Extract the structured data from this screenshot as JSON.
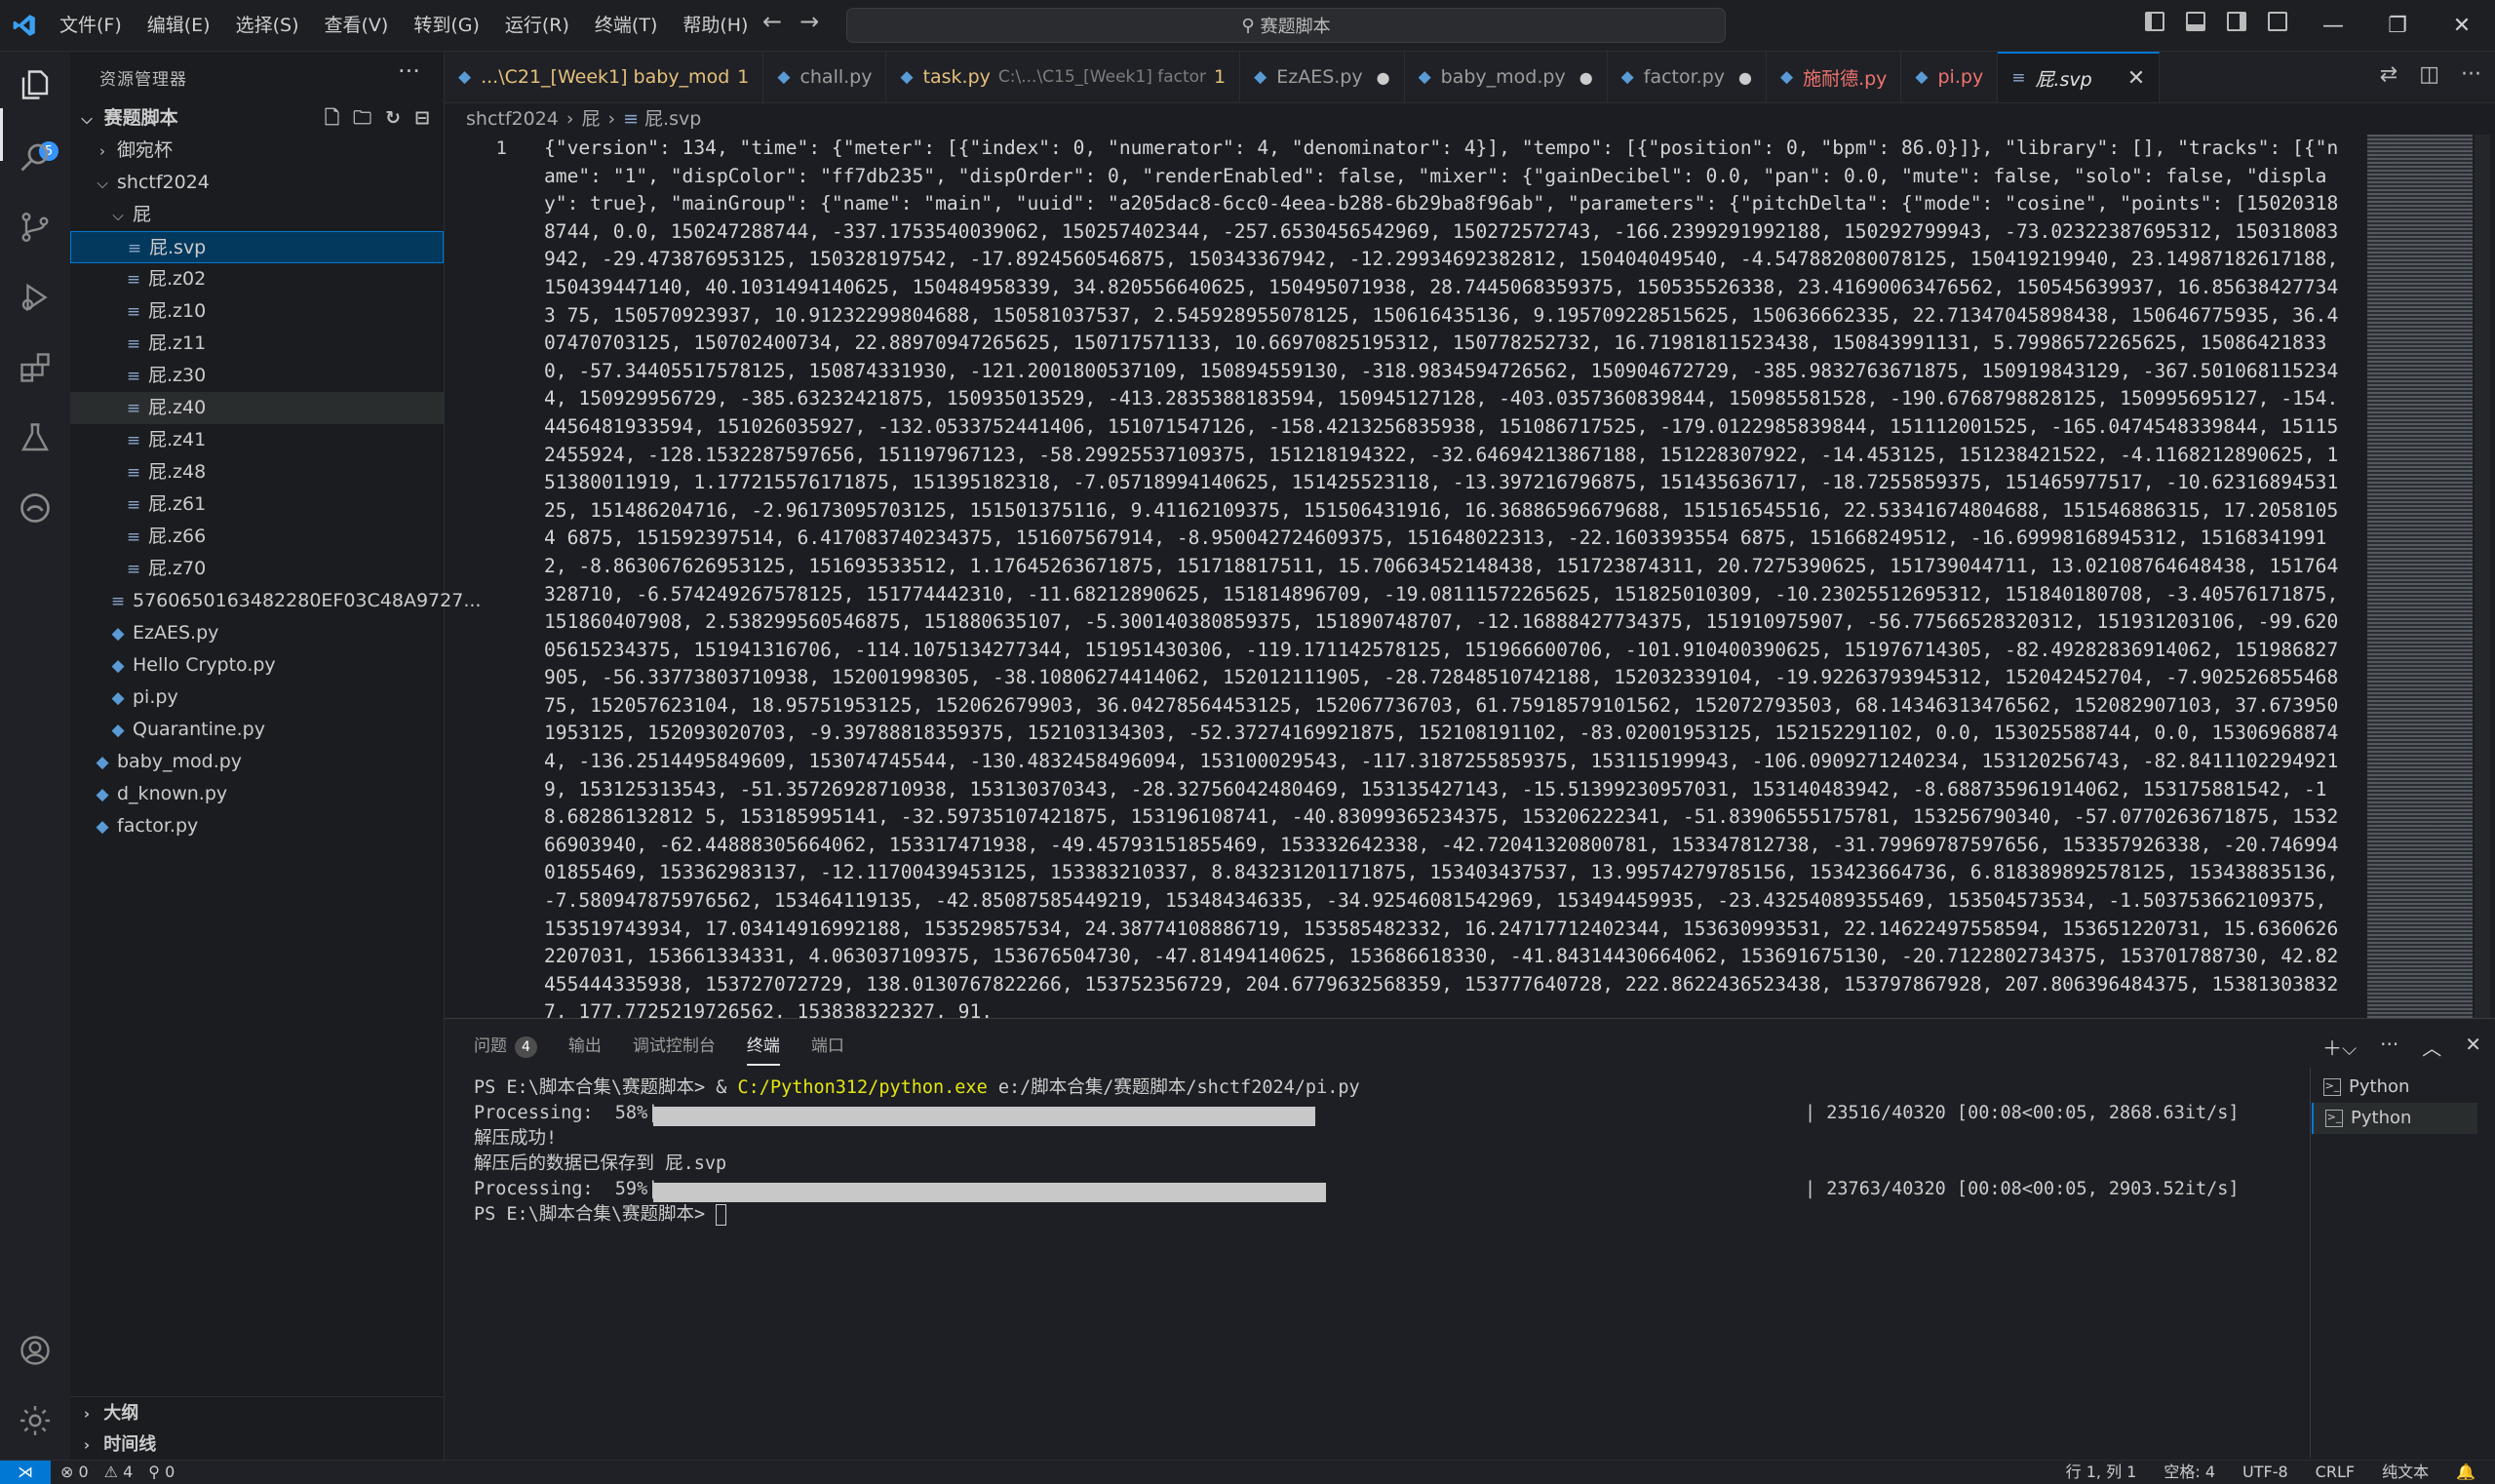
{
  "menu": [
    "文件(F)",
    "编辑(E)",
    "选择(S)",
    "查看(V)",
    "转到(G)",
    "运行(R)",
    "终端(T)",
    "帮助(H)"
  ],
  "search": {
    "label": "赛题脚本"
  },
  "colors": {
    "accent": "#0078d4",
    "selection": "#04395e",
    "terminal_path": "#e5e510",
    "error_tab": "#f0736e"
  },
  "activity": {
    "explorer_badge": "5"
  },
  "sidebar": {
    "title": "资源管理器",
    "root": "赛题脚本",
    "items": [
      {
        "label": "御宛杯",
        "type": "folder",
        "level": 1,
        "open": false
      },
      {
        "label": "shctf2024",
        "type": "folder",
        "level": 1,
        "open": true
      },
      {
        "label": "屁",
        "type": "folder",
        "level": 2,
        "open": true
      },
      {
        "label": "屁.svp",
        "type": "svp",
        "level": 3,
        "selected": true
      },
      {
        "label": "屁.z02",
        "type": "svp",
        "level": 3
      },
      {
        "label": "屁.z10",
        "type": "svp",
        "level": 3
      },
      {
        "label": "屁.z11",
        "type": "svp",
        "level": 3
      },
      {
        "label": "屁.z30",
        "type": "svp",
        "level": 3
      },
      {
        "label": "屁.z40",
        "type": "svp",
        "level": 3,
        "hover": true
      },
      {
        "label": "屁.z41",
        "type": "svp",
        "level": 3
      },
      {
        "label": "屁.z48",
        "type": "svp",
        "level": 3
      },
      {
        "label": "屁.z61",
        "type": "svp",
        "level": 3
      },
      {
        "label": "屁.z66",
        "type": "svp",
        "level": 3
      },
      {
        "label": "屁.z70",
        "type": "svp",
        "level": 3
      },
      {
        "label": "5760650163482280EF03C48A9727...",
        "type": "svp",
        "level": 2
      },
      {
        "label": "EzAES.py",
        "type": "py",
        "level": 2
      },
      {
        "label": "Hello Crypto.py",
        "type": "py",
        "level": 2
      },
      {
        "label": "pi.py",
        "type": "py",
        "level": 2
      },
      {
        "label": "Quarantine.py",
        "type": "py",
        "level": 2
      },
      {
        "label": "baby_mod.py",
        "type": "py",
        "level": 1
      },
      {
        "label": "d_known.py",
        "type": "py",
        "level": 1
      },
      {
        "label": "factor.py",
        "type": "py",
        "level": 1
      }
    ],
    "outline": "大纲",
    "timeline": "时间线"
  },
  "tabs": [
    {
      "label": "...\\C21_[Week1] baby_mod",
      "count": "1",
      "style": "warn"
    },
    {
      "label": "chall.py",
      "style": "normal"
    },
    {
      "label": "task.py",
      "desc": "C:\\...\\C15_[Week1] factor",
      "count": "1",
      "style": "warn"
    },
    {
      "label": "EzAES.py",
      "dot": "●",
      "style": "normal"
    },
    {
      "label": "baby_mod.py",
      "dot": "●",
      "style": "normal"
    },
    {
      "label": "factor.py",
      "dot": "●",
      "style": "normal"
    },
    {
      "label": "施耐德.py",
      "style": "err"
    },
    {
      "label": "pi.py",
      "style": "err"
    },
    {
      "label": "屁.svp",
      "style": "active",
      "close": "✕"
    }
  ],
  "breadcrumb": {
    "parts": [
      "shctf2024",
      "屁",
      "屁.svp"
    ]
  },
  "editor": {
    "line_number": "1",
    "code": "{\"version\": 134, \"time\": {\"meter\": [{\"index\": 0, \"numerator\": 4, \"denominator\": 4}], \"tempo\": [{\"position\": 0, \"bpm\": 86.0}]}, \"library\": [], \"tracks\": [{\"name\": \"1\", \"dispColor\": \"ff7db235\", \"dispOrder\": 0, \"renderEnabled\": false, \"mixer\": {\"gainDecibel\": 0.0, \"pan\": 0.0, \"mute\": false, \"solo\": false, \"display\": true}, \"mainGroup\": {\"name\": \"main\", \"uuid\": \"a205dac8-6cc0-4eea-b288-6b29ba8f96ab\", \"parameters\": {\"pitchDelta\": {\"mode\": \"cosine\", \"points\": [150203188744, 0.0, 150247288744, -337.1753540039062, 150257402344, -257.6530456542969, 150272572743, -166.2399291992188, 150292799943, -73.02322387695312, 150318083942, -29.473876953125, 150328197542, -17.8924560546875, 150343367942, -12.29934692382812, 150404049540, -4.547882080078125, 150419219940, 23.14987182617188, 150439447140, 40.1031494140625, 150484958339, 34.820556640625, 150495071938, 28.7445068359375, 150535526338, 23.41690063476562, 150545639937, 16.856384277343 75, 150570923937, 10.91232299804688, 150581037537, 2.545928955078125, 150616435136, 9.195709228515625, 150636662335, 22.71347045898438, 150646775935, 36.407470703125, 150702400734, 22.88970947265625, 150717571133, 10.66970825195312, 150778252732, 16.71981811523438, 150843991131, 5.79986572265625, 150864218330, -57.34405517578125, 150874331930, -121.2001800537109, 150894559130, -318.9834594726562, 150904672729, -385.9832763671875, 150919843129, -367.5010681152344, 150929956729, -385.63232421875, 150935013529, -413.2835388183594, 150945127128, -403.0357360839844, 150985581528, -190.6768798828125, 150995695127, -154.4456481933594, 151026035927, -132.0533752441406, 151071547126, -158.4213256835938, 151086717525, -179.0122985839844, 151112001525, -165.0474548339844, 151152455924, -128.1532287597656, 151197967123, -58.29925537109375, 151218194322, -32.64694213867188, 151228307922, -14.453125, 151238421522, -4.1168212890625, 151380011919, 1.177215576171875, 151395182318, -7.05718994140625, 151425523118, -13.397216796875, 151435636717, -18.7255859375, 151465977517, -10.6231689453125, 151486204716, -2.96173095703125, 151501375116, 9.41162109375, 151506431916, 16.36886596679688, 151516545516, 22.53341674804688, 151546886315, 17.20581054 6875, 151592397514, 6.417083740234375, 151607567914, -8.950042724609375, 151648022313, -22.1603393554 6875, 151668249512, -16.69998168945312, 151683419912, -8.863067626953125, 151693533512, 1.17645263671875, 151718817511, 15.70663452148438, 151723874311, 20.7275390625, 151739044711, 13.02108764648438, 151764328710, -6.574249267578125, 151774442310, -11.68212890625, 151814896709, -19.08111572265625, 151825010309, -10.23025512695312, 151840180708, -3.40576171875, 151860407908, 2.538299560546875, 151880635107, -5.300140380859375, 151890748707, -12.16888427734375, 151910975907, -56.77566528320312, 151931203106, -99.62005615234375, 151941316706, -114.1075134277344, 151951430306, -119.171142578125, 151966600706, -101.910400390625, 151976714305, -82.49282836914062, 151986827905, -56.33773803710938, 152001998305, -38.10806274414062, 152012111905, -28.72848510742188, 152032339104, -19.92263793945312, 152042452704, -7.90252685546875, 152057623104, 18.95751953125, 152062679903, 36.04278564453125, 152067736703, 61.75918579101562, 152072793503, 68.14346313476562, 152082907103, 37.6739501953125, 152093020703, -9.39788818359375, 152103134303, -52.37274169921875, 152108191102, -83.02001953125, 152152291102, 0.0, 153025588744, 0.0, 153069688744, -136.2514495849609, 153074745544, -130.4832458496094, 153100029543, -117.3187255859375, 153115199943, -106.0909271240234, 153120256743, -82.84111022949219, 153125313543, -51.35726928710938, 153130370343, -28.32756042480469, 153135427143, -15.51399230957031, 153140483942, -8.688735961914062, 153175881542, -18.68286132812 5, 153185995141, -32.59735107421875, 153196108741, -40.83099365234375, 153206222341, -51.83906555175781, 153256790340, -57.0770263671875, 153266903940, -62.44888305664062, 153317471938, -49.45793151855469, 153332642338, -42.72041320800781, 153347812738, -31.79969787597656, 153357926338, -20.74699401855469, 153362983137, -12.11700439453125, 153383210337, 8.843231201171875, 153403437537, 13.99574279785156, 153423664736, 6.818389892578125, 153438835136, -7.580947875976562, 153464119135, -42.85087585449219, 153484346335, -34.92546081542969, 153494459935, -23.43254089355469, 153504573534, -1.503753662109375, 153519743934, 17.03414916992188, 153529857534, 24.38774108886719, 153585482332, 16.24717712402344, 153630993531, 22.14622497558594, 153651220731, 15.63606262207031, 153661334331, 4.063037109375, 153676504730, -47.81494140625, 153686618330, -41.84314430664062, 153691675130, -20.7122802734375, 153701788730, 42.82455444335938, 153727072729, 138.0130767822266, 153752356729, 204.6779632568359, 153777640728, 222.8622436523438, 153797867928, 207.806396484375, 153813038327, 177.7725219726562, 153838322327, 91."
  },
  "panel": {
    "tabs": [
      "问题",
      "输出",
      "调试控制台",
      "终端",
      "端口"
    ],
    "problems_count": "4",
    "active_tab": "终端",
    "terminal_list": [
      "Python",
      "Python"
    ]
  },
  "terminal": {
    "prompt": "PS E:\\脚本合集\\赛题脚本> ",
    "command_amp": "& ",
    "command_exe": "C:/Python312/python.exe",
    "command_arg": " e:/脚本合集/赛题脚本/shctf2024/pi.py",
    "progress1_label": "Processing:  58%|",
    "progress1_fraction": 0.58,
    "progress1_stats": "| 23516/40320 [00:08<00:05, 2868.63it/s]",
    "msg1": "解压成功!",
    "msg2": "解压后的数据已保存到 屁.svp",
    "progress2_label": "Processing:  59%|",
    "progress2_fraction": 0.59,
    "progress2_stats": "| 23763/40320 [00:08<00:05, 2903.52it/s]",
    "prompt_end": "PS E:\\脚本合集\\赛题脚本> "
  },
  "status": {
    "errors": "⊗ 0",
    "warnings": "⚠ 4",
    "ports": "⚲ 0",
    "position": "行 1, 列 1",
    "spaces": "空格: 4",
    "encoding": "UTF-8",
    "eol": "CRLF",
    "language": "纯文本"
  }
}
